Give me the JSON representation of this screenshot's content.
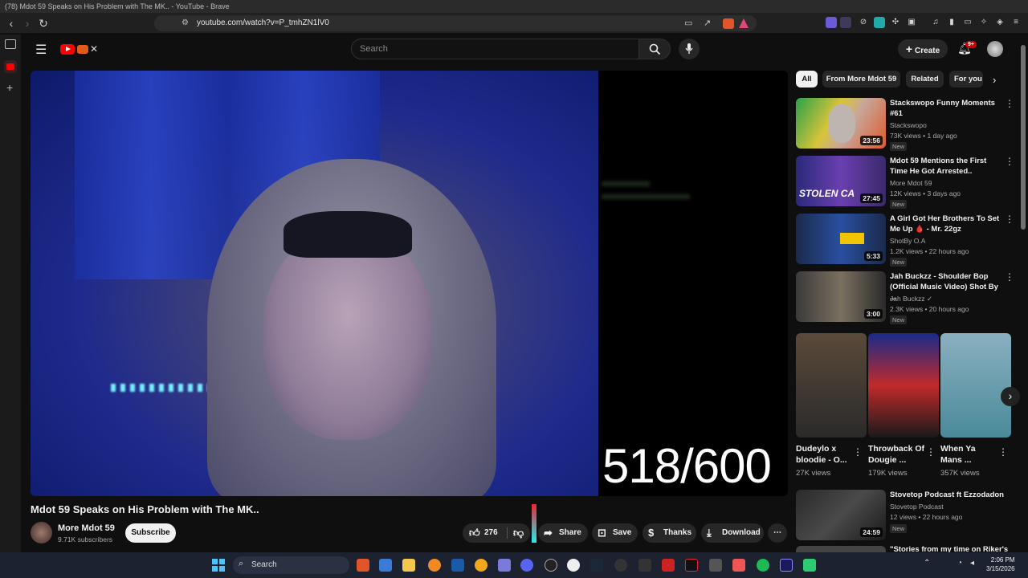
{
  "browser": {
    "window_title": "(78) Mdot 59 Speaks on His Problem with The MK.. - YouTube - Brave",
    "url": "youtube.com/watch?v=P_tmhZN1lV0"
  },
  "header": {
    "search_placeholder": "Search",
    "create_label": "Create",
    "notif_count": "9+"
  },
  "video": {
    "overlay_counter": "518/600",
    "title": "Mdot 59 Speaks on His Problem with The MK..",
    "channel": "More Mdot 59",
    "subscribers": "9.71K subscribers",
    "subscribe_label": "Subscribe",
    "likes": "276",
    "share_label": "Share",
    "save_label": "Save",
    "thanks_label": "Thanks",
    "download_label": "Download"
  },
  "chips": [
    "All",
    "From More Mdot 59",
    "Related",
    "For you"
  ],
  "recommendations": [
    {
      "title_line1": "Stackswopo Funny Moments",
      "title_line2": "#61",
      "channel": "Stackswopo",
      "meta": "73K views • 1 day ago",
      "duration": "23:56",
      "badge": "New"
    },
    {
      "title_line1": "Mdot 59 Mentions the First",
      "title_line2": "Time He Got Arrested..",
      "channel": "More Mdot 59",
      "meta": "12K views • 3 days ago",
      "duration": "27:45",
      "badge": "New"
    },
    {
      "title_line1": "A Girl Got Her Brothers To Set",
      "title_line2": "Me Up 🩸 - Mr. 22gz",
      "channel": "ShotBy O.A",
      "meta": "1.2K views • 22 hours ago",
      "duration": "5:33",
      "badge": "New"
    },
    {
      "title_line1": "Jah Buckzz - Shoulder Bop",
      "title_line2": "(Official Music Video) Shot By ...",
      "channel": "Jah Buckzz",
      "meta": "2.3K views • 20 hours ago",
      "duration": "3:00",
      "badge": "New"
    }
  ],
  "shorts": [
    {
      "title": "Dudeylo x bloodie - O...",
      "views": "27K views"
    },
    {
      "title": "Throwback Of Dougie ...",
      "views": "179K views"
    },
    {
      "title": "When Ya Mans ...",
      "views": "357K views"
    }
  ],
  "more_recs": [
    {
      "title": "Stovetop Podcast ft Ezzodadon",
      "channel": "Stovetop Podcast",
      "meta": "12 views • 22 hours ago",
      "duration": "24:59",
      "badge": "New"
    },
    {
      "title": "\"Stories from my time on Riker's"
    }
  ],
  "taskbar": {
    "search_label": "Search",
    "time": "2:06 PM",
    "date": "3/15/2026"
  },
  "thumb_text": {
    "stolen": "STOLEN CA"
  }
}
